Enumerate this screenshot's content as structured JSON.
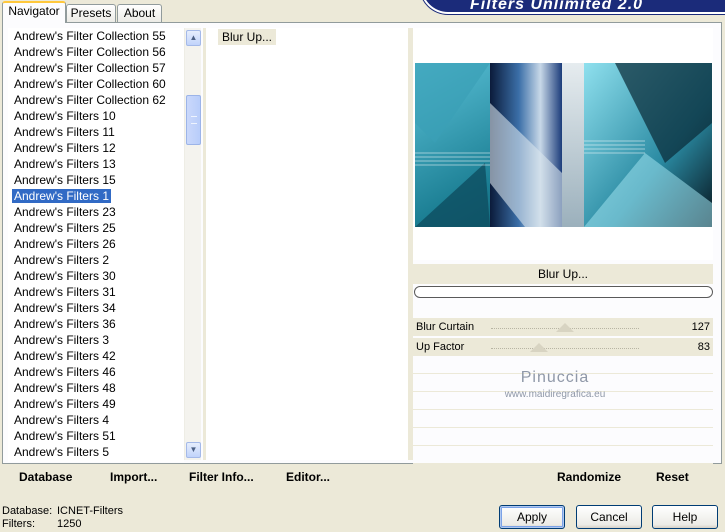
{
  "tabs": [
    "Navigator",
    "Presets",
    "About"
  ],
  "banner": "Filters Unlimited 2.0",
  "categories": [
    "Andrew's Filter Collection 55",
    "Andrew's Filter Collection 56",
    "Andrew's Filter Collection 57",
    "Andrew's Filter Collection 60",
    "Andrew's Filter Collection 62",
    "Andrew's Filters 10",
    "Andrew's Filters 11",
    "Andrew's Filters 12",
    "Andrew's Filters 13",
    "Andrew's Filters 15",
    "Andrew's Filters 1",
    "Andrew's Filters 23",
    "Andrew's Filters 25",
    "Andrew's Filters 26",
    "Andrew's Filters 2",
    "Andrew's Filters 30",
    "Andrew's Filters 31",
    "Andrew's Filters 34",
    "Andrew's Filters 36",
    "Andrew's Filters 3",
    "Andrew's Filters 42",
    "Andrew's Filters 46",
    "Andrew's Filters 48",
    "Andrew's Filters 49",
    "Andrew's Filters 4",
    "Andrew's Filters 51",
    "Andrew's Filters 5"
  ],
  "selected_category": "Andrew's Filters 1",
  "filters": [
    "Blur Up..."
  ],
  "current_filter": "Blur Up...",
  "sliders": [
    {
      "label": "Blur Curtain",
      "value": 127
    },
    {
      "label": "Up Factor",
      "value": 83
    }
  ],
  "watermark": {
    "line1": "Pinuccia",
    "line2": "www.maidiregrafica.eu"
  },
  "bottom_buttons": {
    "database": "Database",
    "import": "Import...",
    "filter_info": "Filter Info...",
    "editor": "Editor...",
    "randomize": "Randomize",
    "reset": "Reset"
  },
  "status": {
    "database_label": "Database:",
    "database_value": "ICNET-Filters",
    "filters_label": "Filters:",
    "filters_value": "1250"
  },
  "dialog_buttons": {
    "apply": "Apply",
    "cancel": "Cancel",
    "help": "Help"
  }
}
